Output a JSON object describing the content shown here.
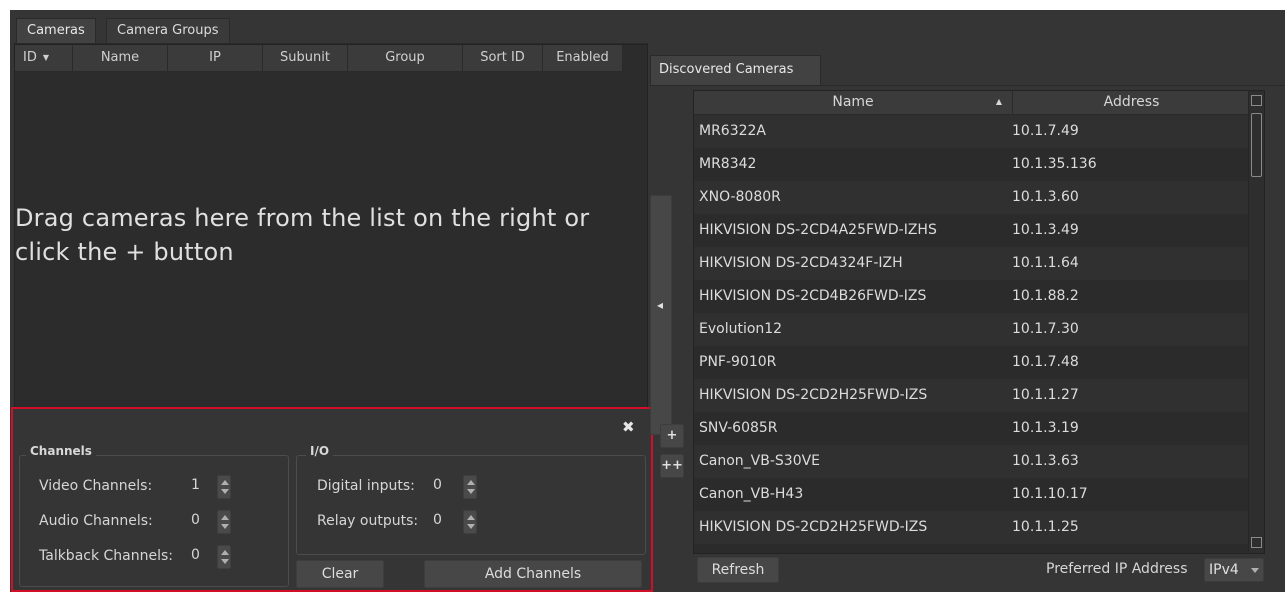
{
  "tabs": [
    "Cameras",
    "Camera Groups"
  ],
  "camera_table": {
    "columns": [
      "ID",
      "Name",
      "IP",
      "Subunit",
      "Group",
      "Sort ID",
      "Enabled"
    ],
    "empty_hint": "Drag cameras here from the list on the right or click the + button"
  },
  "channel_panel": {
    "close_symbol": "✖",
    "channels": {
      "title": "Channels",
      "video_label": "Video Channels:",
      "video_value": "1",
      "audio_label": "Audio Channels:",
      "audio_value": "0",
      "talkback_label": "Talkback Channels:",
      "talkback_value": "0"
    },
    "io": {
      "title": "I/O",
      "digital_label": "Digital inputs:",
      "digital_value": "0",
      "relay_label": "Relay outputs:",
      "relay_value": "0"
    },
    "clear_label": "Clear",
    "add_label": "Add Channels"
  },
  "discovered": {
    "tab": "Discovered Cameras",
    "columns": {
      "name": "Name",
      "address": "Address"
    },
    "rows": [
      {
        "name": "MR6322A",
        "address": "10.1.7.49"
      },
      {
        "name": "MR8342",
        "address": "10.1.35.136"
      },
      {
        "name": "XNO-8080R",
        "address": "10.1.3.60"
      },
      {
        "name": "HIKVISION DS-2CD4A25FWD-IZHS",
        "address": "10.1.3.49"
      },
      {
        "name": "HIKVISION DS-2CD4324F-IZH",
        "address": "10.1.1.64"
      },
      {
        "name": "HIKVISION DS-2CD4B26FWD-IZS",
        "address": "10.1.88.2"
      },
      {
        "name": "Evolution12",
        "address": "10.1.7.30"
      },
      {
        "name": "PNF-9010R",
        "address": "10.1.7.48"
      },
      {
        "name": "HIKVISION DS-2CD2H25FWD-IZS",
        "address": "10.1.1.27"
      },
      {
        "name": "SNV-6085R",
        "address": "10.1.3.19"
      },
      {
        "name": "Canon_VB-S30VE",
        "address": "10.1.3.63"
      },
      {
        "name": "Canon_VB-H43",
        "address": "10.1.10.17"
      },
      {
        "name": "HIKVISION DS-2CD2H25FWD-IZS",
        "address": "10.1.1.25"
      }
    ],
    "refresh_label": "Refresh",
    "pref_ip_label": "Preferred IP Address",
    "pref_ip_value": "IPv4"
  },
  "side_buttons": {
    "move_left": "◂",
    "add": "+",
    "add_all": "++"
  },
  "colors": {
    "panel_bg": "#353535",
    "table_bg": "#2b2b2b",
    "highlight_border": "#d20f28"
  }
}
